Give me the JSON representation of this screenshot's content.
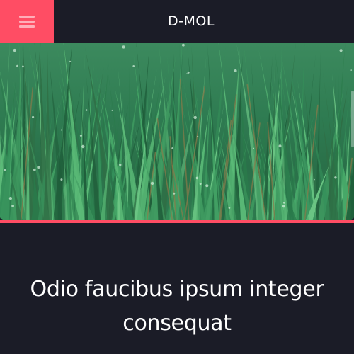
{
  "header": {
    "menu_icon": "hamburger-menu-icon",
    "brand": "D-MOL"
  },
  "hero": {
    "image": "green grass with dew drops"
  },
  "content": {
    "headline": "Odio faucibus ipsum integer consequat"
  },
  "colors": {
    "accent": "#ff4d64",
    "background": "#1b1c27",
    "text": "#ffffff"
  }
}
